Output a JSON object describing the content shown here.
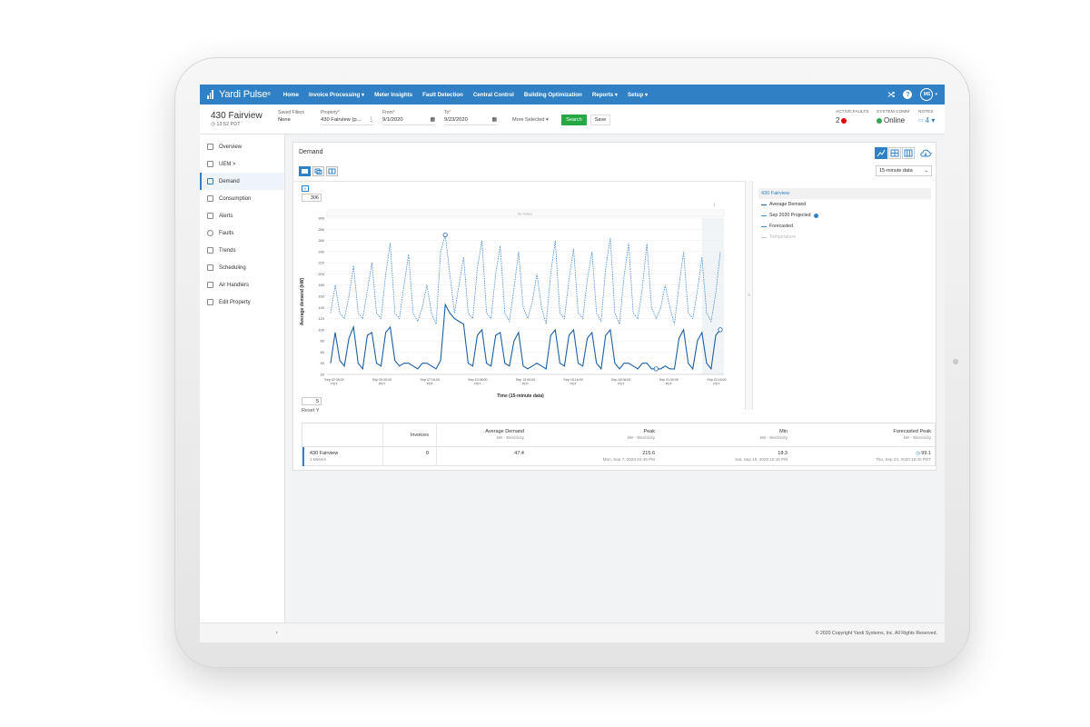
{
  "app": {
    "logo_text": "Yardi Pulse",
    "logo_sup": "®"
  },
  "nav": {
    "items": [
      "Home",
      "Invoice Processing ▾",
      "Meter Insights",
      "Fault Detection",
      "Central Control",
      "Building Optimization",
      "Reports ▾",
      "Setup ▾"
    ],
    "help_label": "?",
    "user_initials": "MS",
    "user_caret": "▾"
  },
  "header": {
    "property_title": "430 Fairview",
    "time": "13:52 PDT",
    "saved_filters_label": "Saved Filters",
    "saved_filters_value": "None",
    "property_label": "Property",
    "property_value": "430 Fairview (p...",
    "from_label": "From",
    "from_value": "9/1/2020",
    "to_label": "To",
    "to_value": "9/23/2020",
    "more_selected": "More Selected ▾",
    "search_label": "Search",
    "save_label": "Save",
    "active_faults_label": "ACTIVE FAULTS",
    "active_faults_value": "2",
    "system_comm_label": "SYSTEM COMM",
    "system_comm_value": "Online",
    "notes_label": "NOTES",
    "notes_value": "4 ▾",
    "required_mark": "*"
  },
  "sidebar": {
    "items": [
      "Overview",
      "UEM >",
      "Demand",
      "Consumption",
      "Alerts",
      "Faults",
      "Trends",
      "Scheduling",
      "Air Handlers",
      "Edit Property"
    ],
    "active": "Demand",
    "collapse_label": "‹"
  },
  "panel": {
    "title": "Demand",
    "interval_value": "15-minute data",
    "ymax_input": "306",
    "ymin_input": "5",
    "reset_label": "Reset Y",
    "info_glyph": "i",
    "splitter_glyph": "»"
  },
  "legend": {
    "header": "430 Fairview",
    "items": [
      "Average Demand",
      "Sep 2020 Projected",
      "Forecasted",
      "Temperature"
    ]
  },
  "chart_data": {
    "type": "line",
    "ylabel": "Average demand (kW)",
    "xlabel": "Time (15-minute data)",
    "no_notes_label": "No Notes",
    "ylim": [
      20,
      300
    ],
    "yticks": [
      20,
      40,
      60,
      80,
      100,
      120,
      140,
      160,
      180,
      200,
      220,
      240,
      260,
      280,
      300
    ],
    "x_ticks": [
      {
        "label": "Sep 02 08:00",
        "sub": "PDT"
      },
      {
        "label": "Sep 05 00:00",
        "sub": "PDT"
      },
      {
        "label": "Sep 07 16:00",
        "sub": "PDT"
      },
      {
        "label": "Sep 10 08:00",
        "sub": "PDT"
      },
      {
        "label": "Sep 13 00:00",
        "sub": "PDT"
      },
      {
        "label": "Sep 15 16:00",
        "sub": "PDT"
      },
      {
        "label": "Sep 18 08:00",
        "sub": "PDT"
      },
      {
        "label": "Sep 21 00:00",
        "sub": "PDT"
      },
      {
        "label": "Sep 23 16:00",
        "sub": "PDT"
      }
    ],
    "series": [
      {
        "name": "Sep 2020 Projected",
        "style": "dashed",
        "color": "#4a8fcf",
        "values": [
          130,
          180,
          130,
          120,
          160,
          215,
          130,
          120,
          170,
          220,
          130,
          120,
          200,
          255,
          130,
          120,
          180,
          235,
          130,
          115,
          140,
          180,
          130,
          110,
          240,
          270,
          200,
          130,
          180,
          230,
          130,
          120,
          210,
          260,
          130,
          120,
          200,
          250,
          130,
          115,
          175,
          240,
          140,
          120,
          150,
          200,
          140,
          110,
          200,
          260,
          130,
          120,
          190,
          245,
          130,
          120,
          190,
          240,
          130,
          115,
          210,
          265,
          130,
          110,
          195,
          255,
          130,
          120,
          175,
          255,
          140,
          120,
          140,
          180,
          140,
          110,
          180,
          240,
          130,
          120,
          170,
          230,
          130,
          115,
          165,
          240
        ]
      },
      {
        "name": "Average Demand",
        "style": "solid",
        "color": "#1c5fa3",
        "values": [
          40,
          95,
          45,
          35,
          85,
          105,
          40,
          30,
          90,
          95,
          40,
          35,
          95,
          105,
          45,
          35,
          40,
          40,
          35,
          30,
          40,
          40,
          35,
          30,
          45,
          145,
          130,
          120,
          115,
          110,
          40,
          35,
          90,
          100,
          40,
          35,
          90,
          95,
          40,
          35,
          80,
          95,
          35,
          30,
          35,
          40,
          35,
          30,
          90,
          100,
          40,
          35,
          90,
          100,
          40,
          35,
          85,
          95,
          40,
          30,
          90,
          100,
          40,
          30,
          40,
          40,
          35,
          30,
          40,
          40,
          30,
          30,
          30,
          35,
          30,
          30,
          85,
          100,
          40,
          30,
          80,
          95,
          40,
          30,
          90,
          100
        ]
      }
    ],
    "markers": [
      {
        "series": "Sep 2020 Projected",
        "index": 25,
        "kind": "max"
      },
      {
        "series": "Average Demand",
        "index": 71,
        "kind": "min"
      },
      {
        "series": "Average Demand",
        "index": 85,
        "kind": "end"
      }
    ]
  },
  "summary": {
    "columns": [
      {
        "label": "Invoices",
        "sub": ""
      },
      {
        "label": "Average Demand",
        "sub": "kW - Electricity"
      },
      {
        "label": "Peak",
        "sub": "kW - Electricity"
      },
      {
        "label": "Min",
        "sub": "kW - Electricity"
      },
      {
        "label": "Forecasted Peak",
        "sub": "kW - Electricity"
      }
    ],
    "row": {
      "name": "430 Fairview",
      "meters": "1 Meters",
      "invoices": "0",
      "average": "47.4",
      "peak": "215.6",
      "peak_time": "Mon, Sep 7, 2020 04:45 PM",
      "min": "18.3",
      "min_time": "Sat, Sep 19, 2020 10:15 PM",
      "forecast_peak": "99.1",
      "forecast_time": "Thu, Sep 24, 2020 15:30 PDT"
    }
  },
  "footer": {
    "copyright": "© 2020 Copyright Yardi Systems, Inc. All Rights Reserved."
  },
  "colors": {
    "brand": "#2f80c4",
    "success": "#27a844",
    "fault": "#dd0000",
    "online": "#2fa84f"
  }
}
